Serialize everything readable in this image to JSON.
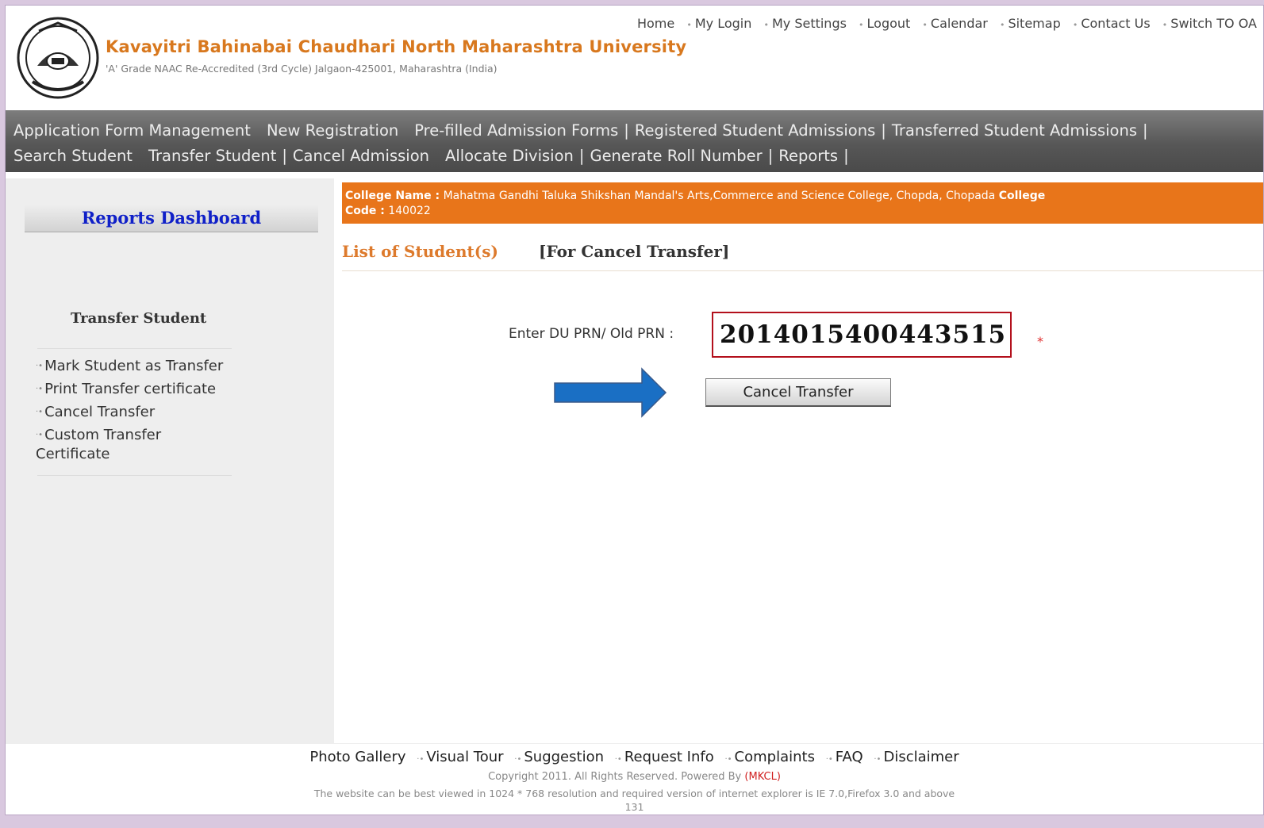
{
  "header": {
    "university_name": "Kavayitri Bahinabai Chaudhari North Maharashtra University",
    "subtitle": "'A' Grade NAAC Re-Accredited (3rd Cycle) Jalgaon-425001, Maharashtra (India)",
    "top_links": [
      "Home",
      "My Login",
      "My Settings",
      "Logout",
      "Calendar",
      "Sitemap",
      "Contact Us",
      "Switch TO OA"
    ]
  },
  "nav": {
    "row1": [
      "Application Form Management",
      "New Registration",
      "Pre-filled Admission Forms",
      "Registered Student Admissions",
      "Transferred Student Admissions"
    ],
    "row2": [
      "Search Student",
      "Transfer Student",
      "Cancel Admission",
      "Allocate Division",
      "Generate Roll Number",
      "Reports"
    ]
  },
  "sidebar": {
    "dashboard_title": "Reports Dashboard",
    "section_title": "Transfer Student",
    "items": [
      "Mark Student as Transfer",
      "Print Transfer certificate",
      "Cancel Transfer",
      "Custom Transfer",
      "Certificate"
    ]
  },
  "main": {
    "college_label": "College Name :",
    "college_name": "Mahatma Gandhi Taluka Shikshan Mandal's Arts,Commerce and Science College, Chopda, Chopada",
    "college_code_label": "College",
    "college_code_label2": "Code :",
    "college_code": "140022",
    "list_title": "List of Student(s)",
    "list_subtitle": "[For Cancel Transfer]",
    "prn_label": "Enter DU PRN/ Old PRN :",
    "prn_value": "2014015400443515",
    "required_marker": "*",
    "cancel_button": "Cancel Transfer"
  },
  "footer": {
    "links": [
      "Photo Gallery",
      "Visual Tour",
      "Suggestion",
      "Request Info",
      "Complaints",
      "FAQ",
      "Disclaimer"
    ],
    "copyright": "Copyright 2011. All Rights Reserved. Powered By",
    "powered_by": "(MKCL)",
    "best_view": "The website can be best viewed in 1024 * 768 resolution and required version of internet explorer is IE 7.0,Firefox 3.0 and above",
    "counter": "131"
  },
  "colors": {
    "accent_orange": "#e8751a",
    "dashboard_blue": "#1020c8",
    "arrow_blue": "#1a6fc4",
    "input_border": "#b3101c"
  },
  "icons": [
    "university-emblem-logo",
    "right-arrow-pointer"
  ]
}
